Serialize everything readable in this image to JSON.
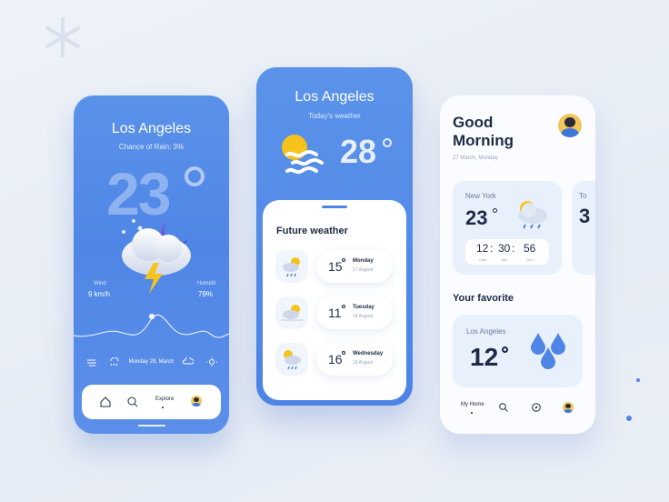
{
  "colors": {
    "primary": "#4f86e6",
    "dark_text": "#1d2a44",
    "muted": "#9aa6bb",
    "card": "#e8f0fc"
  },
  "phone1": {
    "city": "Los Angeles",
    "rain": "Chance of Rain: 3%",
    "temp": "23",
    "wind_label": "Wind",
    "wind_value": "9 km/h",
    "humidity_label": "Humidit",
    "humidity_value": "79%",
    "date": "Monday 29, March",
    "nav": {
      "explore": "Explore"
    }
  },
  "phone2": {
    "city": "Los Angeles",
    "subtitle": "Today's weather",
    "temp": "28",
    "sheet_title": "Future weather",
    "forecast": [
      {
        "temp": "15",
        "day": "Monday",
        "date": "17 August"
      },
      {
        "temp": "11",
        "day": "Tuesday",
        "date": "18 August"
      },
      {
        "temp": "16",
        "day": "Wednesday",
        "date": "19 August"
      }
    ]
  },
  "phone3": {
    "greeting": "Good Morning",
    "date": "27 March, Monday",
    "card": {
      "city": "New York",
      "temp": "23",
      "hour": "12",
      "min": "30",
      "sec": "56",
      "hour_label": "Hour",
      "min_label": "Min",
      "sec_label": "Sec"
    },
    "card_b": {
      "city": "To",
      "temp": "3"
    },
    "favorite_title": "Your favorite",
    "favorite": {
      "city": "Los Angeles",
      "temp": "12"
    },
    "nav": {
      "home": "My Home"
    }
  }
}
